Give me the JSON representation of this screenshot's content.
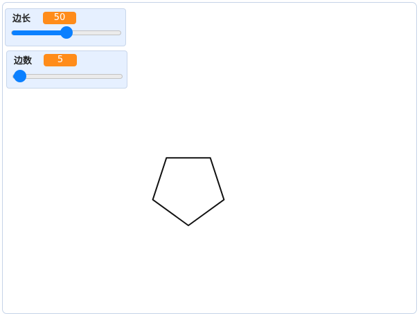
{
  "monitors": [
    {
      "label": "边长",
      "value": "50",
      "slider_min": 0,
      "slider_max": 100,
      "slider_value": 50
    },
    {
      "label": "边数",
      "value": "5",
      "slider_min": 3,
      "slider_max": 100,
      "slider_value": 5
    }
  ],
  "drawing": {
    "shape": "pentagon",
    "sides": 5,
    "stroke_color": "#111111"
  },
  "colors": {
    "value_badge": "#ff8c1a",
    "slider_accent": "#0b80ff",
    "monitor_bg": "#e6f0ff"
  }
}
